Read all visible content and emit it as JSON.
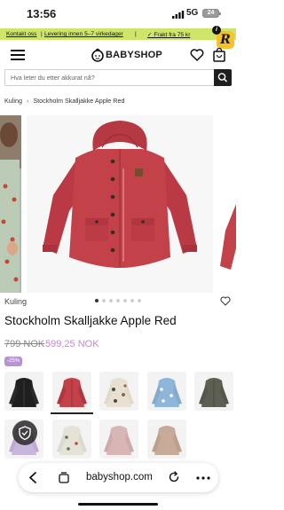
{
  "status_bar": {
    "time": "13:56",
    "network": "5G",
    "battery": "24"
  },
  "promo": {
    "contact": "Kontakt oss",
    "delivery": "Levering innen 5–7 virkedager",
    "shipping": "✓ Frakt fra 75 kr",
    "separator": "|"
  },
  "header": {
    "logo_text": "BABYSHOP"
  },
  "search": {
    "placeholder": "Hva leter du etter akkurat nå?"
  },
  "breadcrumb": {
    "items": [
      "Kuling",
      "Stockholm Skalljakke Apple Red"
    ]
  },
  "product": {
    "brand": "Kuling",
    "title": "Stockholm Skalljakke Apple Red",
    "old_price": "799 NOK",
    "new_price": "599,25 NOK",
    "discount": "-25%",
    "main_color": "#c3424a"
  },
  "variants": {
    "items": [
      {
        "name": "black",
        "color": "#1f1f1f"
      },
      {
        "name": "apple-red",
        "color": "#c3424a"
      },
      {
        "name": "animal-print",
        "color": "#e8e1d2"
      },
      {
        "name": "blue-print",
        "color": "#8fb6d8"
      },
      {
        "name": "olive",
        "color": "#5d5f52"
      },
      {
        "name": "lilac",
        "color": "#c9b6dc"
      },
      {
        "name": "cream-print",
        "color": "#e5e3d8"
      },
      {
        "name": "rose",
        "color": "#d8b6b6"
      },
      {
        "name": "beige",
        "color": "#c8aa98"
      }
    ]
  },
  "browser": {
    "url": "babyshop.com"
  },
  "colors": {
    "promo_bg": "#cde66a",
    "sale": "#c18bd0",
    "accent": "#111111"
  }
}
